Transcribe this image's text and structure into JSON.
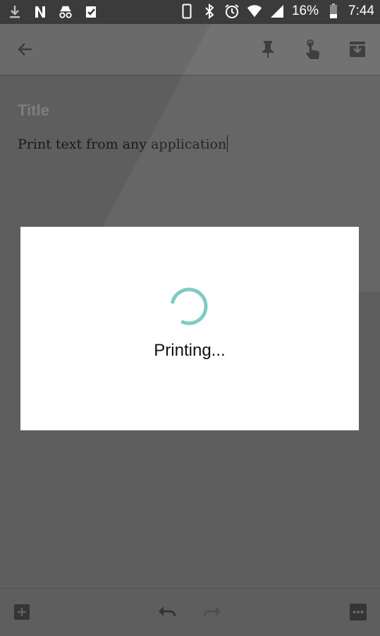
{
  "status_bar": {
    "battery_percent": "16%",
    "time": "7:44",
    "icons_left": [
      "download-icon",
      "netflix-icon",
      "incognito-icon",
      "check-task-icon"
    ],
    "icons_right": [
      "phone-vibrate-icon",
      "bluetooth-icon",
      "alarm-icon",
      "wifi-icon",
      "signal-icon",
      "battery-icon"
    ]
  },
  "toolbar": {
    "icons": [
      "back-arrow-icon",
      "pin-icon",
      "reminder-hand-icon",
      "archive-icon"
    ]
  },
  "note": {
    "title_placeholder": "Title",
    "body_text": "Print text from any application"
  },
  "dialog": {
    "message": "Printing...",
    "spinner_color": "#80cbc4"
  },
  "bottom_bar": {
    "icons": [
      "add-box-icon",
      "undo-icon",
      "redo-icon",
      "more-options-icon"
    ]
  },
  "colors": {
    "scrim_background": "#5e5e5e",
    "status_bar": "#3b3b3b",
    "dialog_background": "#ffffff"
  }
}
